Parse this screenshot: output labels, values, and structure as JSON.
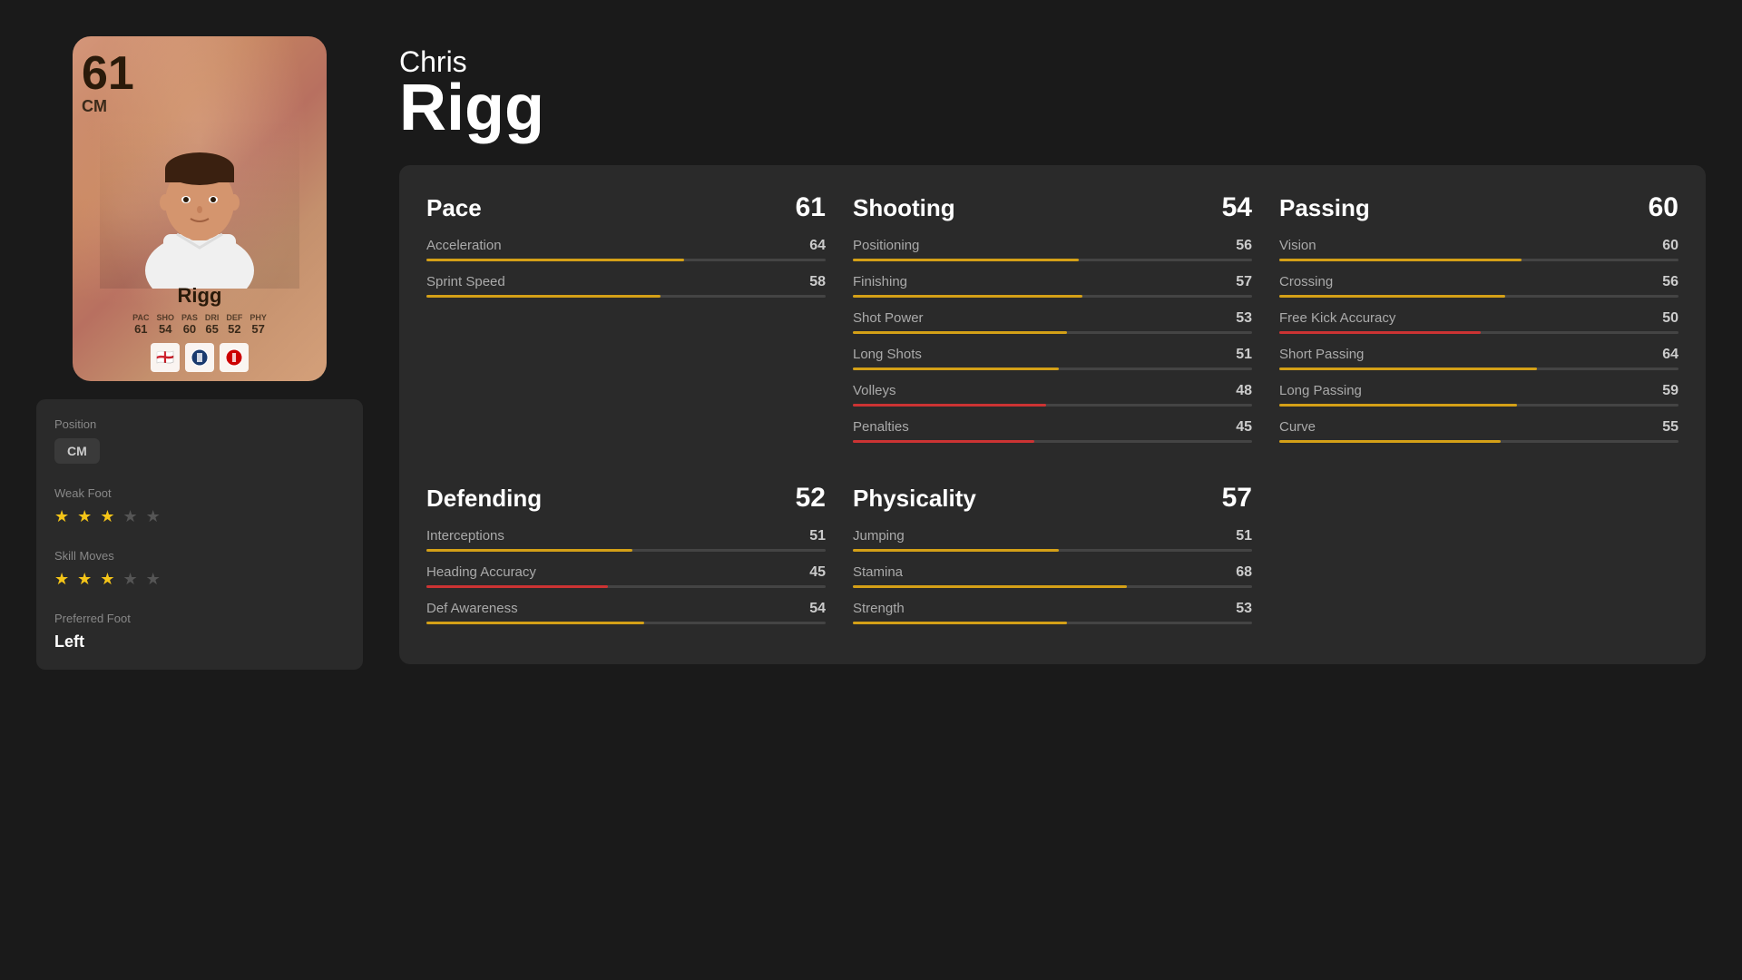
{
  "card": {
    "rating": "61",
    "position": "CM",
    "name": "Rigg",
    "stats_labels": [
      "PAC",
      "SHO",
      "PAS",
      "DRI",
      "DEF",
      "PHY"
    ],
    "stats_values": [
      "61",
      "54",
      "60",
      "65",
      "52",
      "57"
    ]
  },
  "player": {
    "first_name": "Chris",
    "last_name": "Rigg"
  },
  "info": {
    "position_label": "Position",
    "position_value": "CM",
    "weak_foot_label": "Weak Foot",
    "weak_foot_stars": 3,
    "skill_moves_label": "Skill Moves",
    "skill_moves_stars": 3,
    "preferred_foot_label": "Preferred Foot",
    "preferred_foot_value": "Left"
  },
  "stats": {
    "pace": {
      "name": "Pace",
      "score": "61",
      "items": [
        {
          "name": "Acceleration",
          "value": 64,
          "bar_class": "bar-gold"
        },
        {
          "name": "Sprint Speed",
          "value": 58,
          "bar_class": "bar-gold"
        }
      ]
    },
    "shooting": {
      "name": "Shooting",
      "score": "54",
      "items": [
        {
          "name": "Positioning",
          "value": 56,
          "bar_class": "bar-gold"
        },
        {
          "name": "Finishing",
          "value": 57,
          "bar_class": "bar-gold"
        },
        {
          "name": "Shot Power",
          "value": 53,
          "bar_class": "bar-gold"
        },
        {
          "name": "Long Shots",
          "value": 51,
          "bar_class": "bar-gold"
        },
        {
          "name": "Volleys",
          "value": 48,
          "bar_class": "bar-red"
        },
        {
          "name": "Penalties",
          "value": 45,
          "bar_class": "bar-red"
        }
      ]
    },
    "passing": {
      "name": "Passing",
      "score": "60",
      "items": [
        {
          "name": "Vision",
          "value": 60,
          "bar_class": "bar-gold"
        },
        {
          "name": "Crossing",
          "value": 56,
          "bar_class": "bar-gold"
        },
        {
          "name": "Free Kick Accuracy",
          "value": 50,
          "bar_class": "bar-red"
        },
        {
          "name": "Short Passing",
          "value": 64,
          "bar_class": "bar-gold"
        },
        {
          "name": "Long Passing",
          "value": 59,
          "bar_class": "bar-gold"
        },
        {
          "name": "Curve",
          "value": 55,
          "bar_class": "bar-gold"
        }
      ]
    },
    "defending": {
      "name": "Defending",
      "score": "52",
      "items": [
        {
          "name": "Interceptions",
          "value": 51,
          "bar_class": "bar-gold"
        },
        {
          "name": "Heading Accuracy",
          "value": 45,
          "bar_class": "bar-red"
        },
        {
          "name": "Def Awareness",
          "value": 54,
          "bar_class": "bar-gold"
        }
      ]
    },
    "physicality": {
      "name": "Physicality",
      "score": "57",
      "items": [
        {
          "name": "Jumping",
          "value": 51,
          "bar_class": "bar-gold"
        },
        {
          "name": "Stamina",
          "value": 68,
          "bar_class": "bar-gold"
        },
        {
          "name": "Strength",
          "value": 53,
          "bar_class": "bar-gold"
        }
      ]
    }
  }
}
